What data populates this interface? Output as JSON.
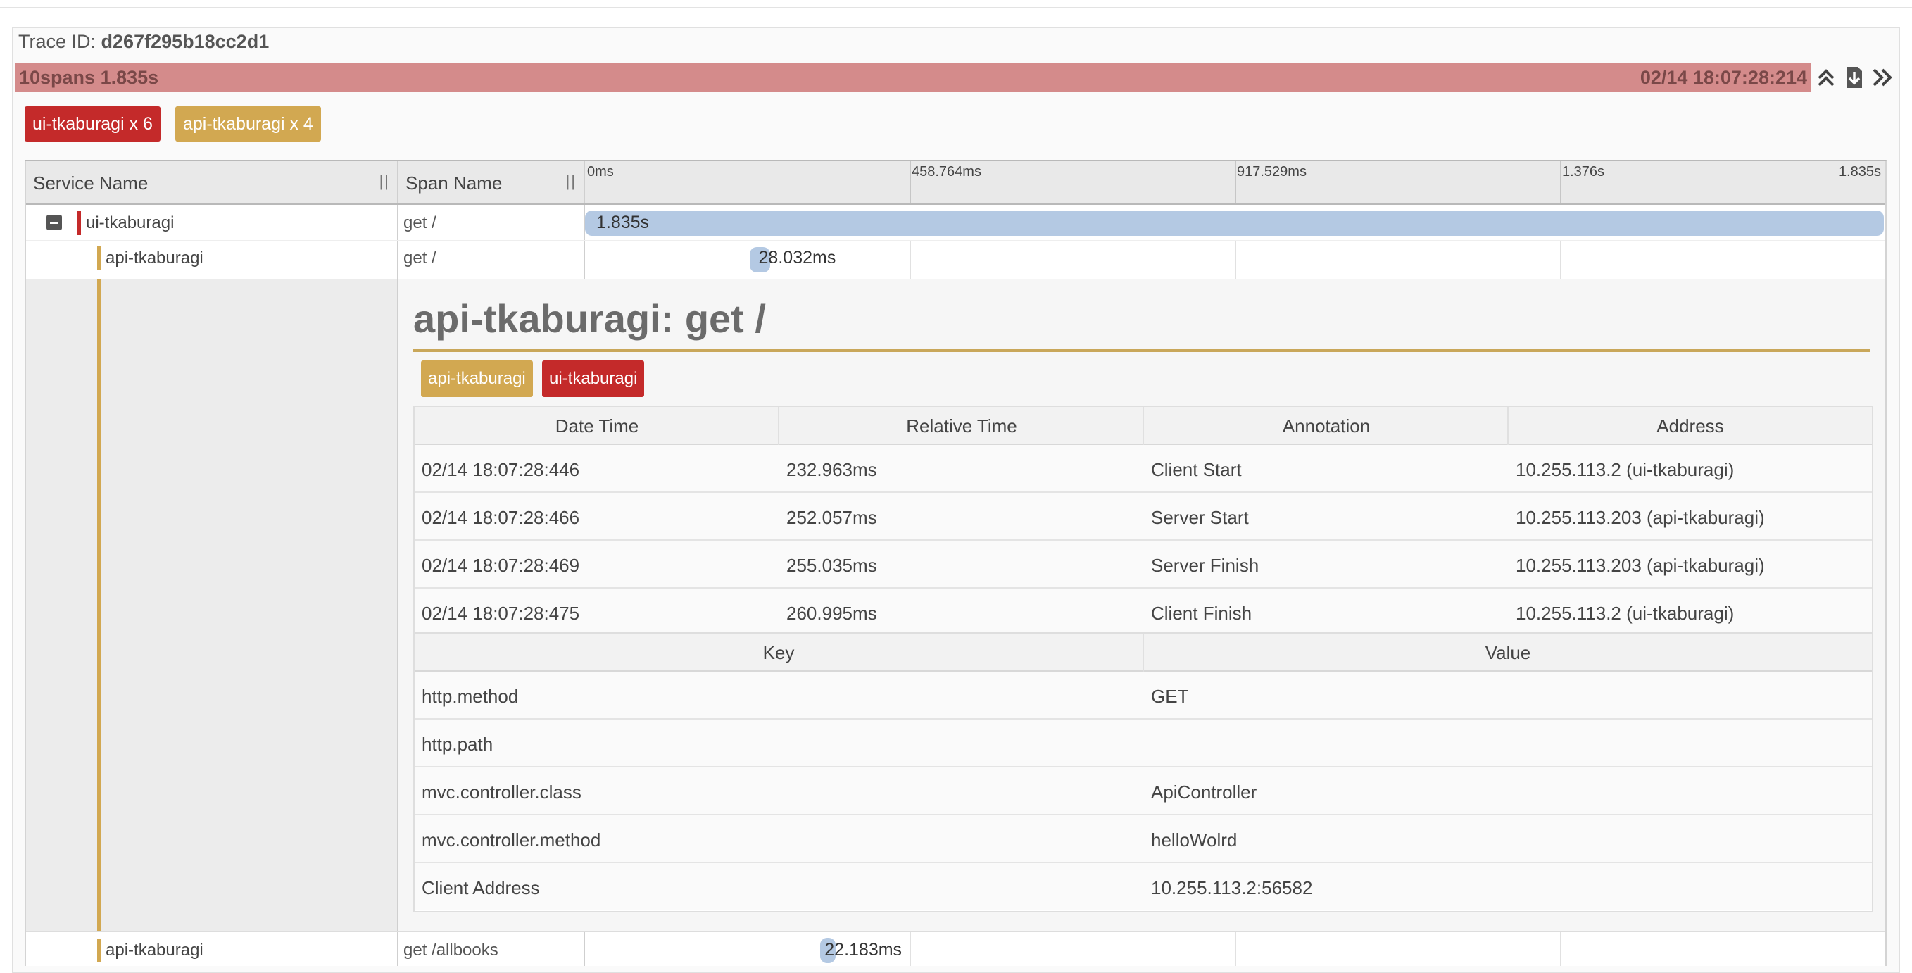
{
  "trace": {
    "id_label": "Trace ID:",
    "id_value": "d267f295b18cc2d1",
    "summary_left": "10spans 1.835s",
    "summary_right": "02/14 18:07:28:214"
  },
  "controls": [
    "collapse-all-icon",
    "download-icon",
    "expand-icon"
  ],
  "colors": {
    "ui": "#c42a2a",
    "api": "#d2a851",
    "span_bar": "#b4c9e3",
    "summary": "#d48b8b"
  },
  "service_badges": [
    {
      "label": "ui-tkaburagi x 6"
    },
    {
      "label": "api-tkaburagi x 4"
    }
  ],
  "columns": {
    "service": "Service Name",
    "span": "Span Name",
    "grip": "||",
    "ticks": [
      "0ms",
      "458.764ms",
      "917.529ms",
      "1.376s",
      "1.835s"
    ]
  },
  "rows": [
    {
      "service": "ui-tkaburagi",
      "span": "get /",
      "duration": "1.835s",
      "start_frac": 0.0,
      "width_frac": 1.0
    },
    {
      "service": "api-tkaburagi",
      "span": "get /",
      "duration": "28.032ms",
      "start_frac": 0.127,
      "width_frac": 0.0153
    },
    {
      "service": "api-tkaburagi",
      "span": "get /allbooks",
      "duration": "22.183ms",
      "start_frac": 0.181,
      "width_frac": 0.0121
    }
  ],
  "detail": {
    "title": "api-tkaburagi: get /",
    "badges": [
      "api-tkaburagi",
      "ui-tkaburagi"
    ],
    "annotation_headers": [
      "Date Time",
      "Relative Time",
      "Annotation",
      "Address"
    ],
    "annotations": [
      [
        "02/14 18:07:28:446",
        "232.963ms",
        "Client Start",
        "10.255.113.2 (ui-tkaburagi)"
      ],
      [
        "02/14 18:07:28:466",
        "252.057ms",
        "Server Start",
        "10.255.113.203 (api-tkaburagi)"
      ],
      [
        "02/14 18:07:28:469",
        "255.035ms",
        "Server Finish",
        "10.255.113.203 (api-tkaburagi)"
      ],
      [
        "02/14 18:07:28:475",
        "260.995ms",
        "Client Finish",
        "10.255.113.2 (ui-tkaburagi)"
      ]
    ],
    "kv_headers": [
      "Key",
      "Value"
    ],
    "kv": [
      [
        "http.method",
        "GET"
      ],
      [
        "http.path",
        ""
      ],
      [
        "mvc.controller.class",
        "ApiController"
      ],
      [
        "mvc.controller.method",
        "helloWolrd"
      ],
      [
        "Client Address",
        "10.255.113.2:56582"
      ]
    ]
  }
}
